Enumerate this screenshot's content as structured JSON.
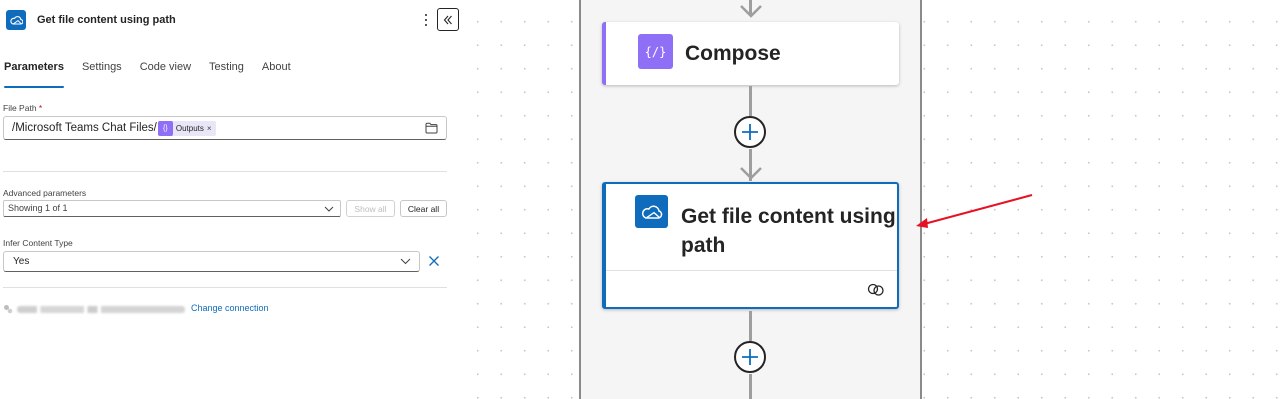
{
  "panel": {
    "title": "Get file content using path",
    "tabs": [
      {
        "label": "Parameters",
        "active": true
      },
      {
        "label": "Settings",
        "active": false
      },
      {
        "label": "Code view",
        "active": false
      },
      {
        "label": "Testing",
        "active": false
      },
      {
        "label": "About",
        "active": false
      }
    ],
    "file_path": {
      "label": "File Path",
      "required_mark": "*",
      "value_text": "/Microsoft Teams Chat Files/",
      "token_label": "Outputs",
      "token_remove": "×"
    },
    "advanced": {
      "label": "Advanced parameters",
      "selected": "Showing 1 of 1",
      "show_all": "Show all",
      "clear_all": "Clear all"
    },
    "infer": {
      "label": "Infer Content Type",
      "selected": "Yes"
    },
    "connection": {
      "change_label": "Change connection"
    }
  },
  "canvas": {
    "compose_title": "Compose",
    "getfile_title": "Get file content using path"
  },
  "colors": {
    "accent": "#0f6cbd",
    "compose": "#8e6ff6",
    "annotation_arrow": "#e81123"
  },
  "icons": [
    "onedrive-icon",
    "more-icon",
    "collapse-icon",
    "folder-icon",
    "compose-icon",
    "link-icon",
    "add-icon",
    "close-icon",
    "chevron-down-icon"
  ]
}
